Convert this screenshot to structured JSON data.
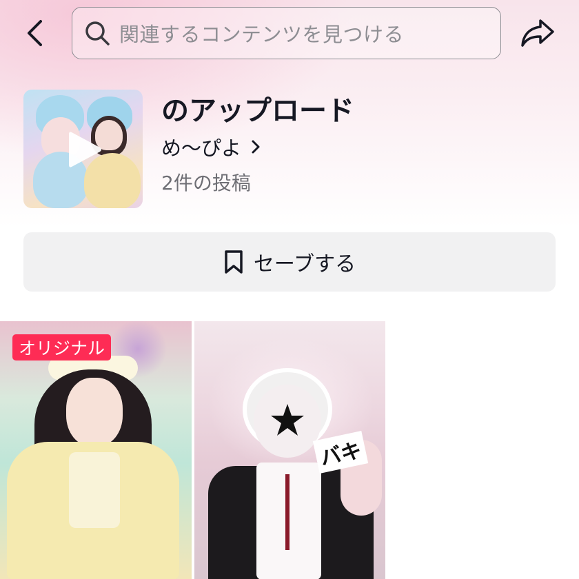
{
  "header": {
    "search_placeholder": "関連するコンテンツを見つける"
  },
  "playlist": {
    "title": "のアップロード",
    "author": "め〜ぴよ",
    "post_count": "2件の投稿"
  },
  "save_button": {
    "label": "セーブする"
  },
  "videos": [
    {
      "badge": "オリジナル",
      "overlay_text": ""
    },
    {
      "overlay_text": "バキ"
    }
  ],
  "colors": {
    "badge": "#fe2c55",
    "text_primary": "#161823",
    "text_secondary": "#6f6f75",
    "save_bg": "#f1f1f2"
  }
}
